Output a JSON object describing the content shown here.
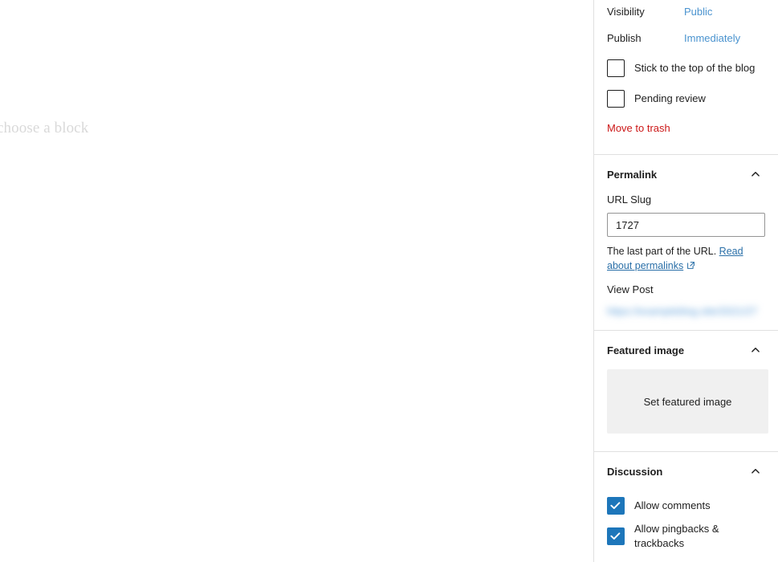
{
  "editor": {
    "block_placeholder": "choose a block"
  },
  "sidebar": {
    "status_panel": {
      "visibility_label": "Visibility",
      "visibility_value": "Public",
      "publish_label": "Publish",
      "publish_value": "Immediately",
      "sticky_label": "Stick to the top of the blog",
      "sticky_checked": false,
      "pending_label": "Pending review",
      "pending_checked": false,
      "trash_label": "Move to trash"
    },
    "permalink_panel": {
      "title": "Permalink",
      "slug_label": "URL Slug",
      "slug_value": "1727",
      "slug_placeholder": "1727",
      "help_prefix": "The last part of the URL.",
      "help_link": "Read about permalinks",
      "view_post_label": "View Post",
      "post_url": "https://exampleblog.site/2021/27"
    },
    "featured_image_panel": {
      "title": "Featured image",
      "button_label": "Set featured image"
    },
    "discussion_panel": {
      "title": "Discussion",
      "allow_comments_label": "Allow comments",
      "allow_comments_checked": true,
      "allow_pingbacks_label": "Allow pingbacks & trackbacks",
      "allow_pingbacks_checked": true
    }
  },
  "colors": {
    "link_blue": "#4a93cf",
    "accent_blue": "#1d76ba",
    "danger_red": "#cc1818",
    "border_gray": "#e0e0e0",
    "placeholder_gray": "#d9d9d9"
  }
}
